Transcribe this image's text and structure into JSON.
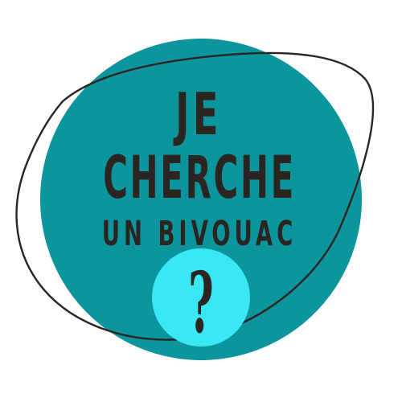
{
  "badge": {
    "line1": "JE",
    "line2": "CHERCHE",
    "line3": "UN BIVOUAC",
    "question_mark": "?"
  },
  "colors": {
    "background": "#ffffff",
    "main_circle": "#0d959d",
    "small_circle": "#39e8f4",
    "ink": "#2b2522",
    "outline": "#2b2522"
  },
  "icons": {
    "main_circle": "teal-disc",
    "outline": "hand-drawn-loop-outline",
    "small_circle": "cyan-disc"
  }
}
